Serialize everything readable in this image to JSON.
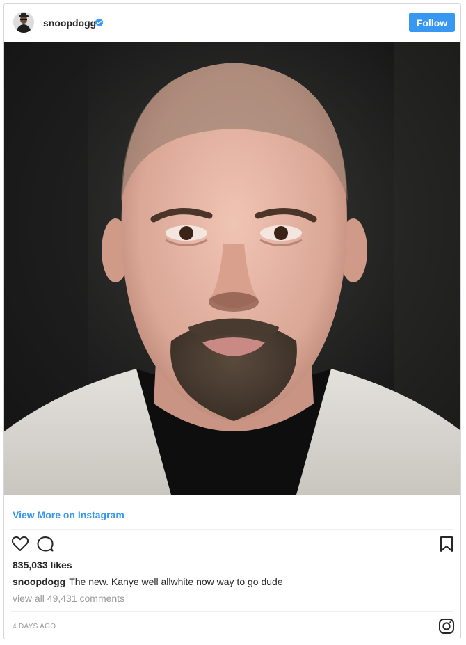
{
  "post": {
    "username": "snoopdogg",
    "follow_label": "Follow",
    "view_more": "View More on Instagram",
    "likes": "835,033 likes",
    "caption_user": "snoopdogg",
    "caption_text": "The new. Kanye well allwhite now way to go dude",
    "comments": "view all 49,431 comments",
    "timestamp": "4 DAYS AGO"
  },
  "icons": {
    "avatar": "profile-avatar",
    "verified": "verified-badge-icon",
    "like": "heart-icon",
    "comment": "comment-icon",
    "save": "bookmark-icon",
    "brand": "instagram-logo-icon"
  },
  "colors": {
    "accent": "#3897f0",
    "text": "#262626",
    "muted": "#999999",
    "border": "#d6d6d6"
  }
}
